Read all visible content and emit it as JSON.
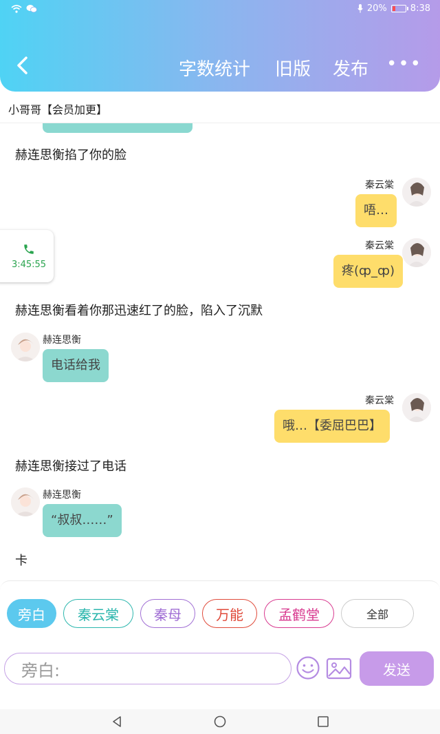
{
  "status": {
    "battery": "20%",
    "time": "8:38"
  },
  "header": {
    "back_icon": "chevron-left-icon",
    "nav": [
      "字数统计",
      "旧版",
      "发布"
    ],
    "more": "•••"
  },
  "subtitle": "小哥哥【会员加更】",
  "timer": {
    "time": "3:45:55",
    "icon": "phone-icon"
  },
  "messages": [
    {
      "type": "narration",
      "text": "赫连思衡掐了你的脸"
    },
    {
      "type": "right",
      "name": "秦云棠",
      "text": "唔…"
    },
    {
      "type": "right",
      "name": "秦云棠",
      "text": "疼(ȹ_ȹ)"
    },
    {
      "type": "narration",
      "text": "赫连思衡看着你那迅速红了的脸，陷入了沉默"
    },
    {
      "type": "left",
      "name": "赫连思衡",
      "text": "电话给我"
    },
    {
      "type": "right",
      "name": "秦云棠",
      "text": "哦…【委屈巴巴】"
    },
    {
      "type": "narration",
      "text": "赫连思衡接过了电话"
    },
    {
      "type": "left",
      "name": "赫连思衡",
      "text": "“叔叔……”"
    },
    {
      "type": "narration",
      "text": "卡"
    }
  ],
  "chips": [
    {
      "label": "旁白",
      "color": "#5cc9ee",
      "active": true
    },
    {
      "label": "秦云棠",
      "color": "#2bb6ad",
      "active": false
    },
    {
      "label": "秦母",
      "color": "#a06ed4",
      "active": false
    },
    {
      "label": "万能",
      "color": "#e04a3a",
      "active": false
    },
    {
      "label": "孟鹤堂",
      "color": "#d8398f",
      "active": false
    },
    {
      "label": "全部",
      "color": "#333333",
      "active": false
    }
  ],
  "input": {
    "placeholder": "旁白:"
  },
  "send_label": "发送"
}
